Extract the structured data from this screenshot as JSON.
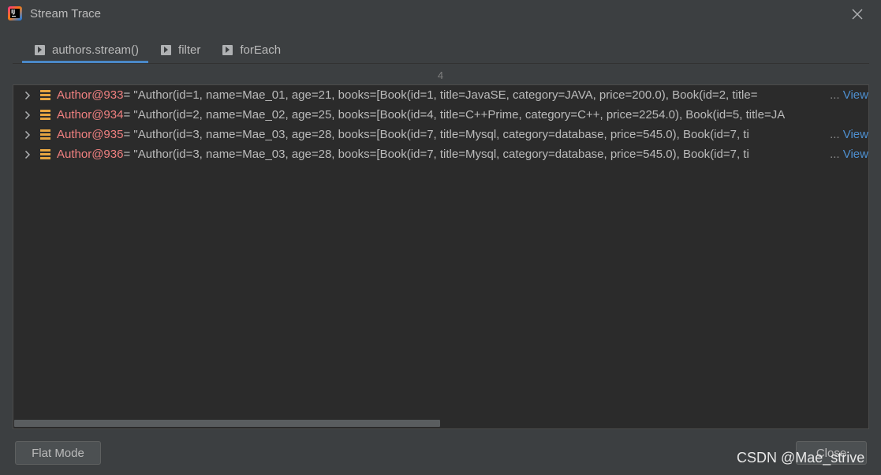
{
  "window": {
    "title": "Stream Trace"
  },
  "tabs": [
    {
      "label": "authors.stream()",
      "active": true
    },
    {
      "label": "filter",
      "active": false
    },
    {
      "label": "forEach",
      "active": false
    }
  ],
  "count": "4",
  "rows": [
    {
      "var": "Author@933",
      "value": " = \"Author(id=1, name=Mae_01, age=21, books=[Book(id=1, title=JavaSE, category=JAVA, price=200.0), Book(id=2, title=",
      "ellipsis": "...",
      "link": " View"
    },
    {
      "var": "Author@934",
      "value": " = \"Author(id=2, name=Mae_02, age=25, books=[Book(id=4, title=C++Prime, category=C++, price=2254.0), Book(id=5, title=JA",
      "ellipsis": "",
      "link": ""
    },
    {
      "var": "Author@935",
      "value": " = \"Author(id=3, name=Mae_03, age=28, books=[Book(id=7, title=Mysql, category=database, price=545.0), Book(id=7, ti",
      "ellipsis": "...",
      "link": " View"
    },
    {
      "var": "Author@936",
      "value": " = \"Author(id=3, name=Mae_03, age=28, books=[Book(id=7, title=Mysql, category=database, price=545.0), Book(id=7, ti",
      "ellipsis": "...",
      "link": " View"
    }
  ],
  "buttons": {
    "flat_mode": "Flat Mode",
    "close": "Close"
  },
  "watermark": "CSDN @Mae_strive",
  "icons": {
    "app": "intellij-idea-icon",
    "close": "close-icon",
    "tab": "play-arrow-icon",
    "expand": "chevron-right-icon",
    "object": "object-list-icon"
  },
  "colors": {
    "background": "#3c3f41",
    "panel": "#2b2b2b",
    "variable": "#f08080",
    "link": "#4e8fcf",
    "tab_underline": "#4a88c7",
    "object_icon": "#e5a441"
  }
}
